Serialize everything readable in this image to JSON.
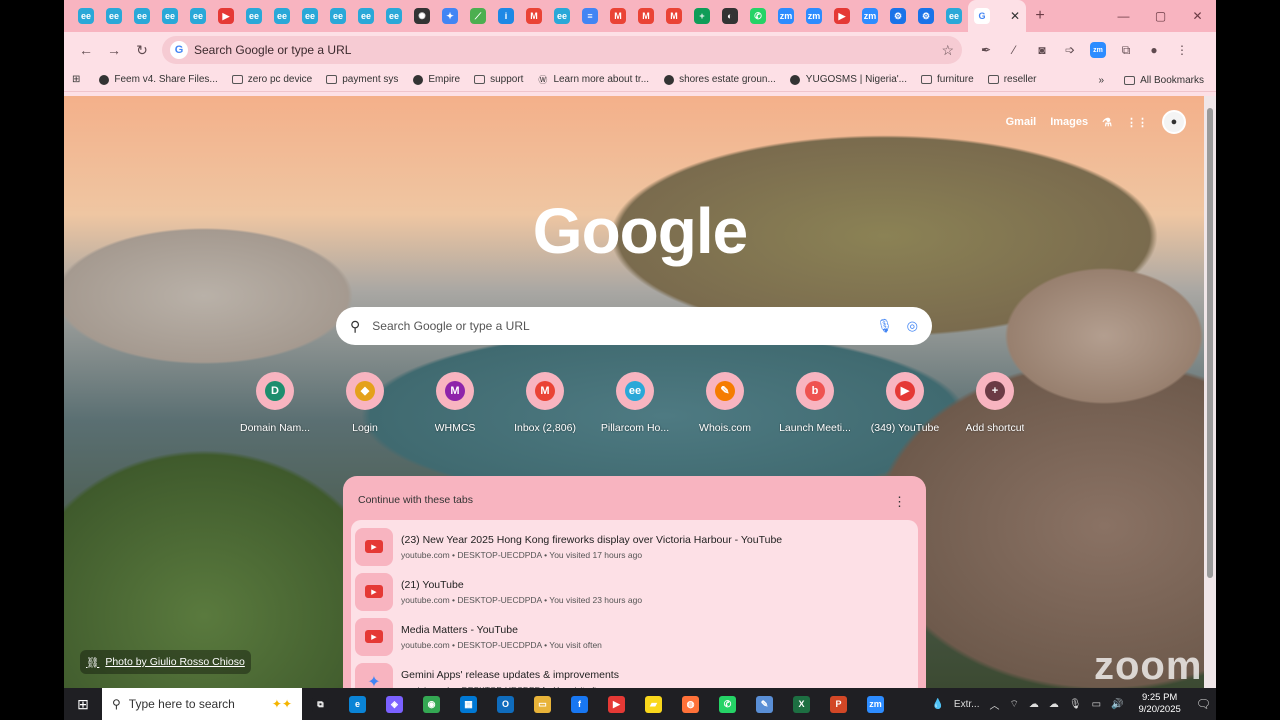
{
  "browser": {
    "tabs": [
      {
        "icon": "feem-icon",
        "glyph": "ee",
        "color": "#2aa8d8"
      },
      {
        "icon": "feem-icon",
        "glyph": "ee",
        "color": "#2aa8d8"
      },
      {
        "icon": "feem-icon",
        "glyph": "ee",
        "color": "#2aa8d8"
      },
      {
        "icon": "feem-icon",
        "glyph": "ee",
        "color": "#2aa8d8"
      },
      {
        "icon": "feem-icon",
        "glyph": "ee",
        "color": "#2aa8d8"
      },
      {
        "icon": "youtube-icon",
        "glyph": "▶",
        "color": "#e53935"
      },
      {
        "icon": "feem-icon",
        "glyph": "ee",
        "color": "#2aa8d8"
      },
      {
        "icon": "feem-icon",
        "glyph": "ee",
        "color": "#2aa8d8"
      },
      {
        "icon": "feem-icon",
        "glyph": "ee",
        "color": "#2aa8d8"
      },
      {
        "icon": "feem-icon",
        "glyph": "ee",
        "color": "#2aa8d8"
      },
      {
        "icon": "feem-icon",
        "glyph": "ee",
        "color": "#2aa8d8"
      },
      {
        "icon": "feem-icon",
        "glyph": "ee",
        "color": "#2aa8d8"
      },
      {
        "icon": "openai-icon",
        "glyph": "✺",
        "color": "#333333"
      },
      {
        "icon": "gemini-icon",
        "glyph": "✦",
        "color": "#4285f4"
      },
      {
        "icon": "leaf-icon",
        "glyph": "⟋",
        "color": "#4caf50"
      },
      {
        "icon": "page-icon",
        "glyph": "i",
        "color": "#1e88e5"
      },
      {
        "icon": "gmail-icon",
        "glyph": "M",
        "color": "#ea4335"
      },
      {
        "icon": "feem-icon",
        "glyph": "ee",
        "color": "#2aa8d8"
      },
      {
        "icon": "docs-icon",
        "glyph": "≡",
        "color": "#4285f4"
      },
      {
        "icon": "gmail-icon",
        "glyph": "M",
        "color": "#ea4335"
      },
      {
        "icon": "gmail-icon",
        "glyph": "M",
        "color": "#ea4335"
      },
      {
        "icon": "gmail-icon",
        "glyph": "M",
        "color": "#ea4335"
      },
      {
        "icon": "sheets-icon",
        "glyph": "+",
        "color": "#0f9d58"
      },
      {
        "icon": "globe-icon",
        "glyph": "◐",
        "color": "#333333"
      },
      {
        "icon": "whatsapp-icon",
        "glyph": "✆",
        "color": "#25d366"
      },
      {
        "icon": "zoom-icon",
        "glyph": "zm",
        "color": "#2d8cff"
      },
      {
        "icon": "zoom-icon",
        "glyph": "zm",
        "color": "#2d8cff"
      },
      {
        "icon": "youtube-icon",
        "glyph": "▶",
        "color": "#e53935"
      },
      {
        "icon": "zoom-icon",
        "glyph": "zm",
        "color": "#2d8cff"
      },
      {
        "icon": "settings-icon",
        "glyph": "⚙",
        "color": "#1a73e8"
      },
      {
        "icon": "settings-icon",
        "glyph": "⚙",
        "color": "#1a73e8"
      },
      {
        "icon": "feem-icon",
        "glyph": "ee",
        "color": "#2aa8d8"
      }
    ],
    "active_tab": {
      "icon": "google-icon",
      "glyph": "G",
      "color": "#4285f4",
      "close": "✕"
    },
    "new_tab": "+",
    "window_buttons": {
      "minimize": "—",
      "maximize": "▢",
      "close": "✕"
    },
    "omnibox_placeholder": "Search Google or type a URL",
    "bookmarks": [
      {
        "label": "Feem v4. Share Files...",
        "icon": "globe"
      },
      {
        "label": "zero pc device",
        "icon": "folder"
      },
      {
        "label": "payment sys",
        "icon": "folder"
      },
      {
        "label": "Empire",
        "icon": "globe"
      },
      {
        "label": "support",
        "icon": "folder"
      },
      {
        "label": "Learn more about tr...",
        "icon": "wordpress"
      },
      {
        "label": "shores estate groun...",
        "icon": "globe"
      },
      {
        "label": "YUGOSMS | Nigeria'...",
        "icon": "globe"
      },
      {
        "label": "furniture",
        "icon": "folder"
      },
      {
        "label": "reseller",
        "icon": "folder"
      }
    ],
    "bookmarks_overflow": "»",
    "all_bookmarks": "All Bookmarks"
  },
  "ntp": {
    "gmail_link": "Gmail",
    "images_link": "Images",
    "logo": "Google",
    "search_placeholder": "Search Google or type a URL",
    "shortcuts": [
      {
        "label": "Domain Nam...",
        "glyph": "D",
        "color": "#1e8e6e"
      },
      {
        "label": "Login",
        "glyph": "◆",
        "color": "#e4a11b"
      },
      {
        "label": "WHMCS",
        "glyph": "M",
        "color": "#8e24aa"
      },
      {
        "label": "Inbox (2,806)",
        "glyph": "M",
        "color": "#ea4335"
      },
      {
        "label": "Pillarcom Ho...",
        "glyph": "ee",
        "color": "#2aa8d8"
      },
      {
        "label": "Whois.com",
        "glyph": "✎",
        "color": "#f57c00"
      },
      {
        "label": "Launch Meeti...",
        "glyph": "b",
        "color": "#ef5350"
      },
      {
        "label": "(349) YouTube",
        "glyph": "▶",
        "color": "#e53935"
      },
      {
        "label": "Add shortcut",
        "glyph": "+",
        "color": "#6b3b45"
      }
    ],
    "continue_title": "Continue with these tabs",
    "continue_items": [
      {
        "title": "(23) New Year 2025 Hong Kong fireworks display over Victoria Harbour - YouTube",
        "meta": "youtube.com • DESKTOP-UECDPDA • You visited 17 hours ago",
        "icon": "youtube"
      },
      {
        "title": "(21) YouTube",
        "meta": "youtube.com • DESKTOP-UECDPDA • You visited 23 hours ago",
        "icon": "youtube"
      },
      {
        "title": "Media Matters - YouTube",
        "meta": "youtube.com • DESKTOP-UECDPDA • You visit often",
        "icon": "youtube"
      },
      {
        "title": "Gemini Apps' release updates & improvements",
        "meta": "gemini.google • DESKTOP-UECDPDA • You visit often",
        "icon": "gemini"
      }
    ],
    "photo_credit": "Photo by Giulio Rosso Chioso"
  },
  "watermark": "zoom",
  "taskbar": {
    "search_placeholder": "Type here to search",
    "apps": [
      {
        "icon": "task-view-icon",
        "glyph": "⧉",
        "color": "#1f1f23"
      },
      {
        "icon": "edge-icon",
        "glyph": "e",
        "color": "#0a84d6"
      },
      {
        "icon": "copilot-icon",
        "glyph": "◈",
        "color": "#7b61ff"
      },
      {
        "icon": "chrome-icon",
        "glyph": "◉",
        "color": "#34a853"
      },
      {
        "icon": "store-icon",
        "glyph": "▦",
        "color": "#0078d4"
      },
      {
        "icon": "outlook-icon",
        "glyph": "O",
        "color": "#0f6cbd"
      },
      {
        "icon": "file-explorer-icon",
        "glyph": "▭",
        "color": "#e8b339"
      },
      {
        "icon": "facebook-icon",
        "glyph": "f",
        "color": "#1877f2"
      },
      {
        "icon": "youtube-icon",
        "glyph": "▶",
        "color": "#e53935"
      },
      {
        "icon": "sticky-notes-icon",
        "glyph": "▰",
        "color": "#f9d71c"
      },
      {
        "icon": "firefox-icon",
        "glyph": "◍",
        "color": "#ff7139"
      },
      {
        "icon": "whatsapp-icon",
        "glyph": "✆",
        "color": "#25d366"
      },
      {
        "icon": "notepad-icon",
        "glyph": "✎",
        "color": "#5a8fd6"
      },
      {
        "icon": "excel-icon",
        "glyph": "X",
        "color": "#1d6f42"
      },
      {
        "icon": "powerpoint-icon",
        "glyph": "P",
        "color": "#d24726"
      },
      {
        "icon": "zoom-icon",
        "glyph": "zm",
        "color": "#2d8cff"
      }
    ],
    "weather_label": "Extr...",
    "time": "9:25 PM",
    "date": "9/20/2025"
  }
}
